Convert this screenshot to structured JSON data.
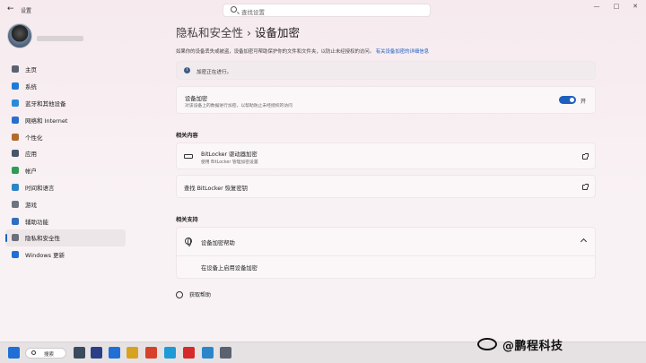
{
  "titlebar": {
    "back_icon": "back-arrow-icon",
    "app_title": "设置",
    "search_placeholder": "查找设置",
    "minimize": "—",
    "maximize": "□",
    "close": "✕"
  },
  "sidebar": {
    "items": [
      {
        "label": "主页",
        "icon": "home-icon",
        "color": "#5a6270"
      },
      {
        "label": "系统",
        "icon": "system-icon",
        "color": "#1f7ad6"
      },
      {
        "label": "蓝牙和其他设备",
        "icon": "bluetooth-icon",
        "color": "#2a8ad8"
      },
      {
        "label": "网络和 Internet",
        "icon": "wifi-icon",
        "color": "#2a6fd0"
      },
      {
        "label": "个性化",
        "icon": "brush-icon",
        "color": "#b46a2a"
      },
      {
        "label": "应用",
        "icon": "apps-icon",
        "color": "#48566a"
      },
      {
        "label": "帐户",
        "icon": "account-icon",
        "color": "#2f9c55"
      },
      {
        "label": "时间和语言",
        "icon": "globe-clock-icon",
        "color": "#2a86c8"
      },
      {
        "label": "游戏",
        "icon": "game-icon",
        "color": "#6b7480"
      },
      {
        "label": "辅助功能",
        "icon": "accessibility-icon",
        "color": "#2f6fc0"
      },
      {
        "label": "隐私和安全性",
        "icon": "shield-icon",
        "color": "#6b6f78",
        "active": true
      },
      {
        "label": "Windows 更新",
        "icon": "update-icon",
        "color": "#1f6fd6"
      }
    ]
  },
  "main": {
    "breadcrumb_parent": "隐私和安全性",
    "breadcrumb_sep": "›",
    "breadcrumb_current": "设备加密",
    "description": "如果你的设备丢失或被盗，设备加密可帮助保护你的文件和文件夹，以防止未经授权的访问。",
    "description_link": "有关设备加密的详细信息",
    "info_text": "加密正在进行。",
    "device_encryption": {
      "title": "设备加密",
      "subtitle": "对该设备上的数据进行加密，以帮助防止未经授权的访问",
      "toggle_label": "开",
      "state": "on"
    },
    "related_title": "相关内容",
    "bitlocker": {
      "title": "BitLocker 驱动器加密",
      "subtitle": "使用 BitLocker 管理加密设置"
    },
    "recovery_key": "查找 BitLocker 恢复密钥",
    "support_title": "相关支持",
    "help": {
      "title": "设备加密帮助",
      "link": "在设备上启用设备加密"
    },
    "get_help": "获取帮助"
  },
  "taskbar": {
    "search_label": "搜索",
    "watermark": "@鹏程科技",
    "items": [
      {
        "icon": "start-icon",
        "color": "#1f6fd6"
      },
      {
        "icon": "task-view-icon",
        "color": "#3b4a5e"
      },
      {
        "icon": "ai-icon",
        "color": "#2b3f86"
      },
      {
        "icon": "mail-icon",
        "color": "#1f6fd6"
      },
      {
        "icon": "store-icon",
        "color": "#d6a21f"
      },
      {
        "icon": "chrome-icon",
        "color": "#d6412a"
      },
      {
        "icon": "edge-icon",
        "color": "#1f9ad6"
      },
      {
        "icon": "wps-icon",
        "color": "#d62a2a"
      },
      {
        "icon": "notepad-icon",
        "color": "#2a86c8"
      },
      {
        "icon": "settings-gear-icon",
        "color": "#5a6270"
      }
    ]
  }
}
